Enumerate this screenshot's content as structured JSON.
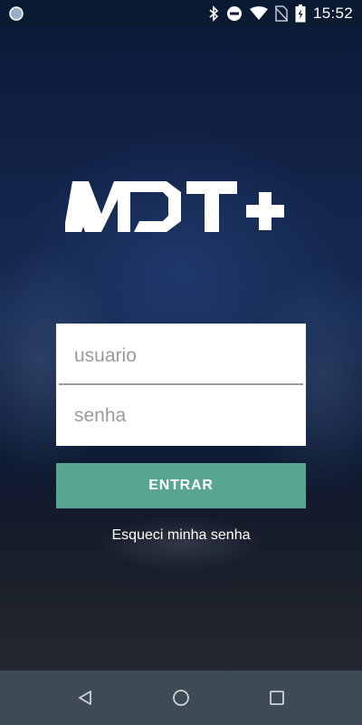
{
  "status_bar": {
    "time": "15:52",
    "icons": [
      "circle-notification-icon",
      "bluetooth-icon",
      "do-not-disturb-icon",
      "wifi-icon",
      "no-sim-icon",
      "battery-charging-icon"
    ]
  },
  "app": {
    "logo_text": "MDT+",
    "colors": {
      "accent": "#58a592",
      "background_top": "#13254b",
      "background_bottom": "#0a0f1a",
      "nav_bar": "#3f4b54"
    }
  },
  "login": {
    "username_placeholder": "usuario",
    "username_value": "",
    "password_placeholder": "senha",
    "password_value": "",
    "submit_label": "ENTRAR",
    "forgot_password_label": "Esqueci minha senha"
  },
  "nav_bar": {
    "icons": [
      "back-icon",
      "home-icon",
      "recents-icon"
    ]
  }
}
